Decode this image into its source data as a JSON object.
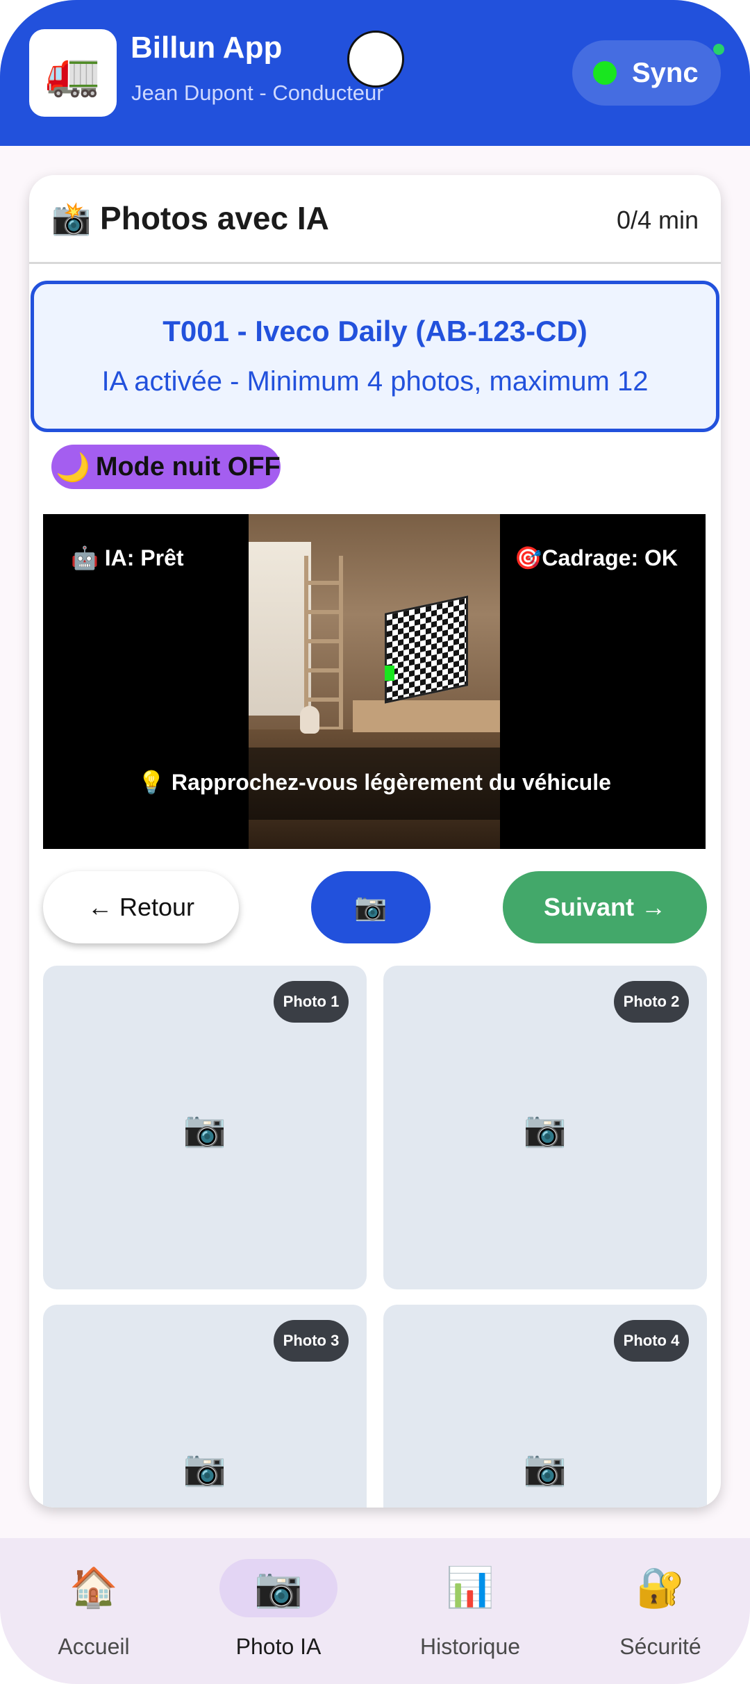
{
  "header": {
    "logo_icon": "🚛",
    "title": "Billun App",
    "subtitle": "Jean Dupont - Conducteur",
    "sync_label": "Sync",
    "sync_status_color": "#19e61f",
    "brand_color": "#2251dc"
  },
  "card": {
    "title": "📸 Photos avec IA",
    "timer": "0/4 min",
    "vehicle_name": "T001 - Iveco Daily (AB-123-CD)",
    "ia_info": "IA activée - Minimum 4 photos, maximum 12",
    "night_mode_icon": "🌙",
    "night_mode_label": "Mode nuit OFF"
  },
  "camera": {
    "ia_status": "🤖 IA: Prêt",
    "framing_status": "🎯Cadrage: OK",
    "hint": "💡 Rapprochez-vous légèrement du véhicule"
  },
  "actions": {
    "back_label": "← Retour",
    "capture_icon": "📷",
    "next_label": "Suivant →"
  },
  "photo_slots": [
    {
      "label": "Photo 1",
      "icon": "📷"
    },
    {
      "label": "Photo 2",
      "icon": "📷"
    },
    {
      "label": "Photo 3",
      "icon": "📷"
    },
    {
      "label": "Photo 4",
      "icon": "📷"
    }
  ],
  "bottom_nav": [
    {
      "icon": "🏠",
      "label": "Accueil",
      "active": false
    },
    {
      "icon": "📷",
      "label": "Photo IA",
      "active": true
    },
    {
      "icon": "📊",
      "label": "Historique",
      "active": false
    },
    {
      "icon": "🔐",
      "label": "Sécurité",
      "active": false
    }
  ]
}
